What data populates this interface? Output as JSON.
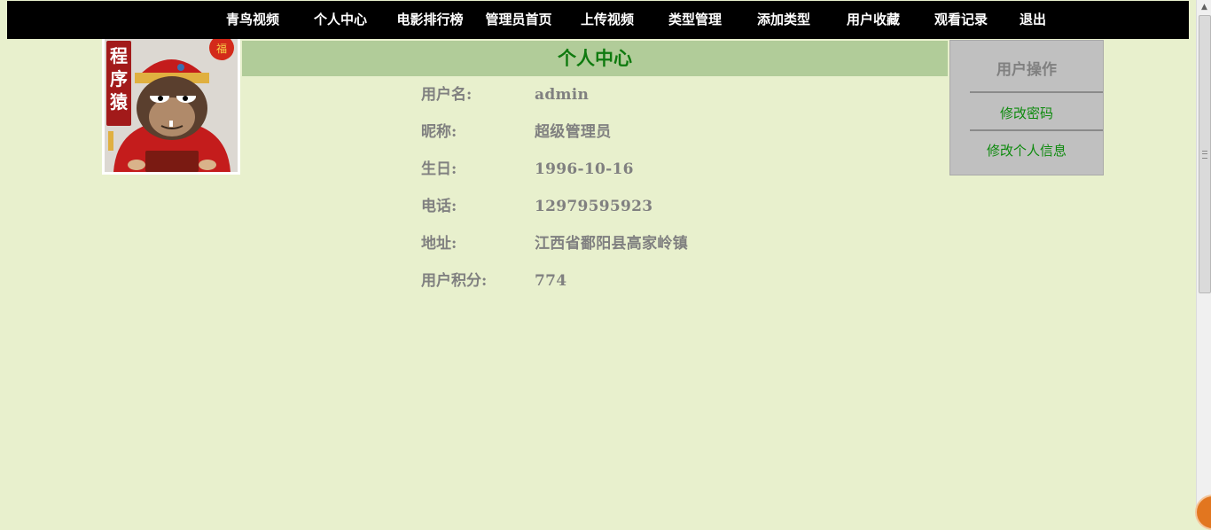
{
  "nav": {
    "items": [
      {
        "label": "青鸟视频"
      },
      {
        "label": "个人中心"
      },
      {
        "label": "电影排行榜"
      },
      {
        "label": "管理员首页"
      },
      {
        "label": "上传视频"
      },
      {
        "label": "类型管理"
      },
      {
        "label": "添加类型"
      },
      {
        "label": "用户收藏"
      },
      {
        "label": "观看记录"
      },
      {
        "label": "退出"
      }
    ]
  },
  "avatar": {
    "caption_text": "程序猿",
    "fu_text": "福"
  },
  "panel": {
    "title": "个人中心",
    "fields": [
      {
        "label": "用户名:",
        "value": "admin"
      },
      {
        "label": "昵称:",
        "value": "超级管理员"
      },
      {
        "label": "生日:",
        "value": "1996-10-16"
      },
      {
        "label": "电话:",
        "value": "12979595923"
      },
      {
        "label": "地址:",
        "value": "江西省鄱阳县高家岭镇"
      },
      {
        "label": "用户积分:",
        "value": "774"
      }
    ]
  },
  "ops": {
    "title": "用户操作",
    "links": [
      {
        "label": "修改密码"
      },
      {
        "label": "修改个人信息"
      }
    ]
  },
  "scrollbar": {
    "up_arrow": "▲"
  },
  "colors": {
    "page_bg": "#e8f0cd",
    "nav_bg": "#000000",
    "header_bg": "#b1cc99",
    "header_text": "#0f7a0f",
    "link_green": "#0d8a0d",
    "ops_bg": "#c0c0c0",
    "field_text": "#808080"
  }
}
